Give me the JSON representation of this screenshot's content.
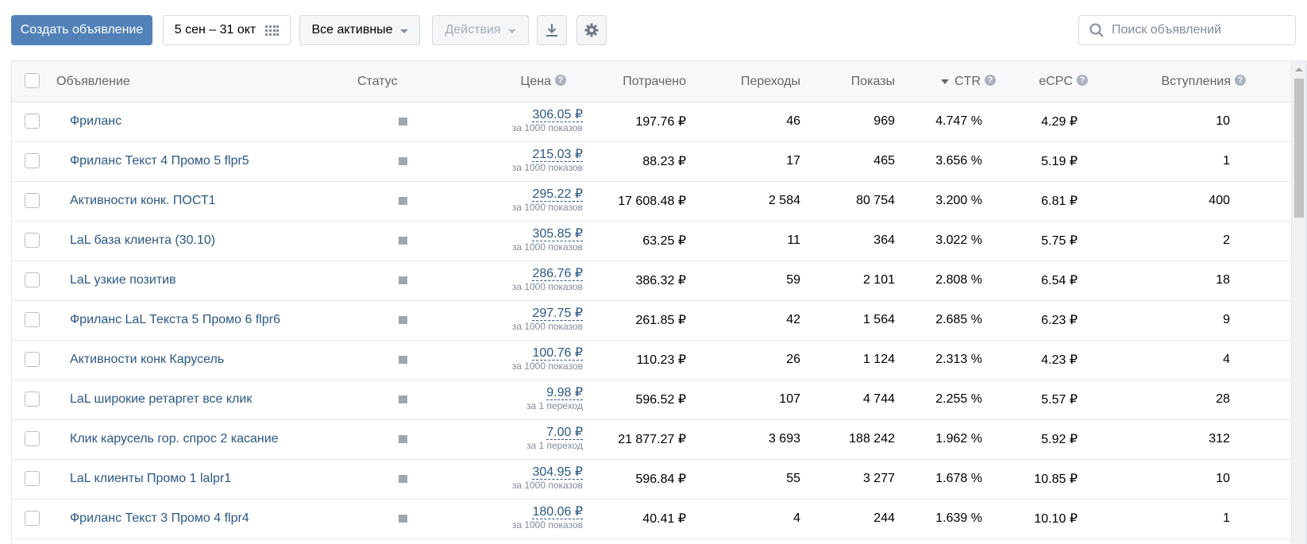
{
  "toolbar": {
    "create_label": "Создать объявление",
    "date_label": "5 сен – 31 окт",
    "filter_label": "Все активные",
    "actions_label": "Действия",
    "search_placeholder": "Поиск объявлений"
  },
  "icons": {
    "calendar": "calendar-grid-icon",
    "download": "download-icon",
    "settings": "gear-icon",
    "search": "search-icon"
  },
  "colors": {
    "primary": "#5181b8",
    "link": "#2a5885",
    "status_inactive": "#a0a6ae"
  },
  "table": {
    "headers": {
      "ad": "Объявление",
      "status": "Статус",
      "price": "Цена",
      "spent": "Потрачено",
      "clicks": "Переходы",
      "impressions": "Показы",
      "ctr": "CTR",
      "ecpc": "eCPC",
      "joins": "Вступления"
    },
    "rows": [
      {
        "name": "Фриланс",
        "price": "306.05 ₽",
        "price_unit": "за 1000 показов",
        "spent": "197.76 ₽",
        "clicks": "46",
        "impressions": "969",
        "ctr": "4.747 %",
        "ecpc": "4.29 ₽",
        "joins": "10"
      },
      {
        "name": "Фриланс Текст 4 Промо 5 flpr5",
        "price": "215.03 ₽",
        "price_unit": "за 1000 показов",
        "spent": "88.23 ₽",
        "clicks": "17",
        "impressions": "465",
        "ctr": "3.656 %",
        "ecpc": "5.19 ₽",
        "joins": "1"
      },
      {
        "name": "Активности конк. ПОСТ1",
        "price": "295.22 ₽",
        "price_unit": "за 1000 показов",
        "spent": "17 608.48 ₽",
        "clicks": "2 584",
        "impressions": "80 754",
        "ctr": "3.200 %",
        "ecpc": "6.81 ₽",
        "joins": "400"
      },
      {
        "name": "LaL база клиента (30.10)",
        "price": "305.85 ₽",
        "price_unit": "за 1000 показов",
        "spent": "63.25 ₽",
        "clicks": "11",
        "impressions": "364",
        "ctr": "3.022 %",
        "ecpc": "5.75 ₽",
        "joins": "2"
      },
      {
        "name": "LaL узкие позитив",
        "price": "286.76 ₽",
        "price_unit": "за 1000 показов",
        "spent": "386.32 ₽",
        "clicks": "59",
        "impressions": "2 101",
        "ctr": "2.808 %",
        "ecpc": "6.54 ₽",
        "joins": "18"
      },
      {
        "name": "Фриланс LaL Текста 5 Промо 6 flpr6",
        "price": "297.75 ₽",
        "price_unit": "за 1000 показов",
        "spent": "261.85 ₽",
        "clicks": "42",
        "impressions": "1 564",
        "ctr": "2.685 %",
        "ecpc": "6.23 ₽",
        "joins": "9"
      },
      {
        "name": "Активности конк Карусель",
        "price": "100.76 ₽",
        "price_unit": "за 1000 показов",
        "spent": "110.23 ₽",
        "clicks": "26",
        "impressions": "1 124",
        "ctr": "2.313 %",
        "ecpc": "4.23 ₽",
        "joins": "4"
      },
      {
        "name": "LaL широкие ретаргет все клик",
        "price": "9.98 ₽",
        "price_unit": "за 1 переход",
        "spent": "596.52 ₽",
        "clicks": "107",
        "impressions": "4 744",
        "ctr": "2.255 %",
        "ecpc": "5.57 ₽",
        "joins": "28"
      },
      {
        "name": "Клик карусель гор. спрос 2 касание",
        "price": "7.00 ₽",
        "price_unit": "за 1 переход",
        "spent": "21 877.27 ₽",
        "clicks": "3 693",
        "impressions": "188 242",
        "ctr": "1.962 %",
        "ecpc": "5.92 ₽",
        "joins": "312"
      },
      {
        "name": "LaL клиенты Промо 1 lalpr1",
        "price": "304.95 ₽",
        "price_unit": "за 1000 показов",
        "spent": "596.84 ₽",
        "clicks": "55",
        "impressions": "3 277",
        "ctr": "1.678 %",
        "ecpc": "10.85 ₽",
        "joins": "10"
      },
      {
        "name": "Фриланс Текст 3 Промо 4 flpr4",
        "price": "180.06 ₽",
        "price_unit": "за 1000 показов",
        "spent": "40.41 ₽",
        "clicks": "4",
        "impressions": "244",
        "ctr": "1.639 %",
        "ecpc": "10.10 ₽",
        "joins": "1"
      }
    ]
  }
}
